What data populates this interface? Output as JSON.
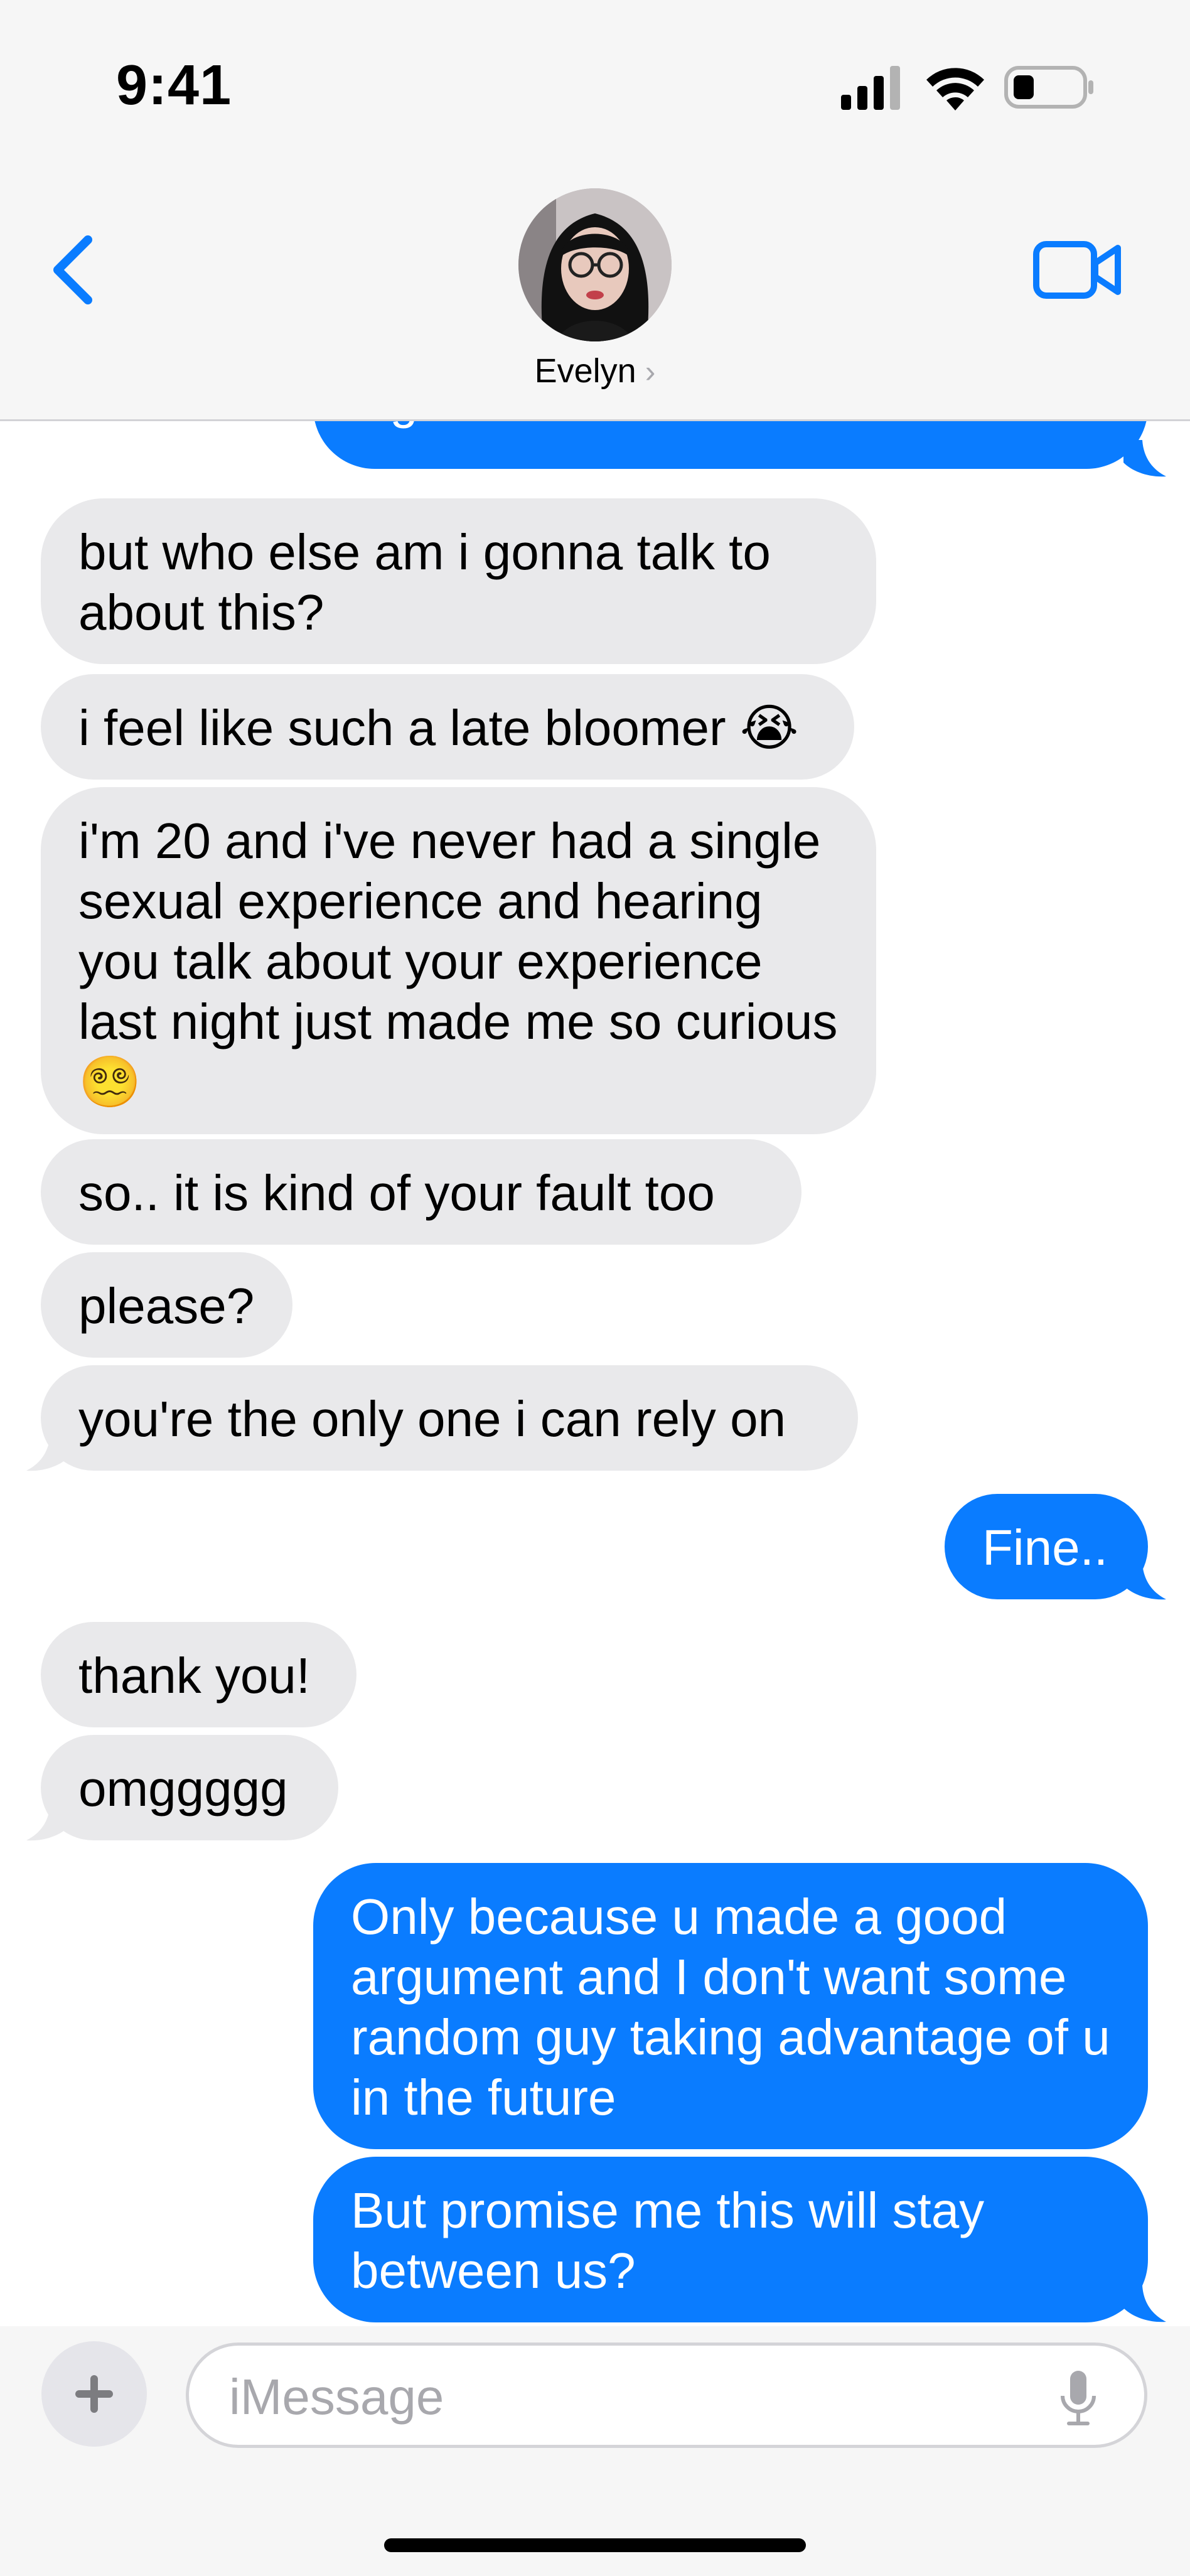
{
  "status": {
    "time": "9:41"
  },
  "header": {
    "contact_name": "Evelyn",
    "chevron": "›"
  },
  "messages": [
    {
      "from": "me",
      "text": "night"
    },
    {
      "from": "them",
      "text": "but who else am i gonna talk to about this?"
    },
    {
      "from": "them",
      "text": "i feel like such a late bloomer 😭"
    },
    {
      "from": "them",
      "text": "i'm 20 and i've never had a single sexual experience and hearing you talk about your experience last night just made me so curious 😵‍💫"
    },
    {
      "from": "them",
      "text": "so.. it is kind of your fault too"
    },
    {
      "from": "them",
      "text": "please?"
    },
    {
      "from": "them",
      "text": "you're the only one i can rely on"
    },
    {
      "from": "me",
      "text": "Fine.."
    },
    {
      "from": "them",
      "text": "thank you!"
    },
    {
      "from": "them",
      "text": "omggggg"
    },
    {
      "from": "me",
      "text": "Only because u made a good argument and I don't want some random guy taking advantage of u in the future"
    },
    {
      "from": "me",
      "text": "But promise me this will stay between us?"
    }
  ],
  "input": {
    "placeholder": "iMessage",
    "plus_label": "+"
  },
  "colors": {
    "outgoing": "#0a7cff",
    "incoming": "#e9e9eb",
    "accent": "#0a7cff"
  }
}
